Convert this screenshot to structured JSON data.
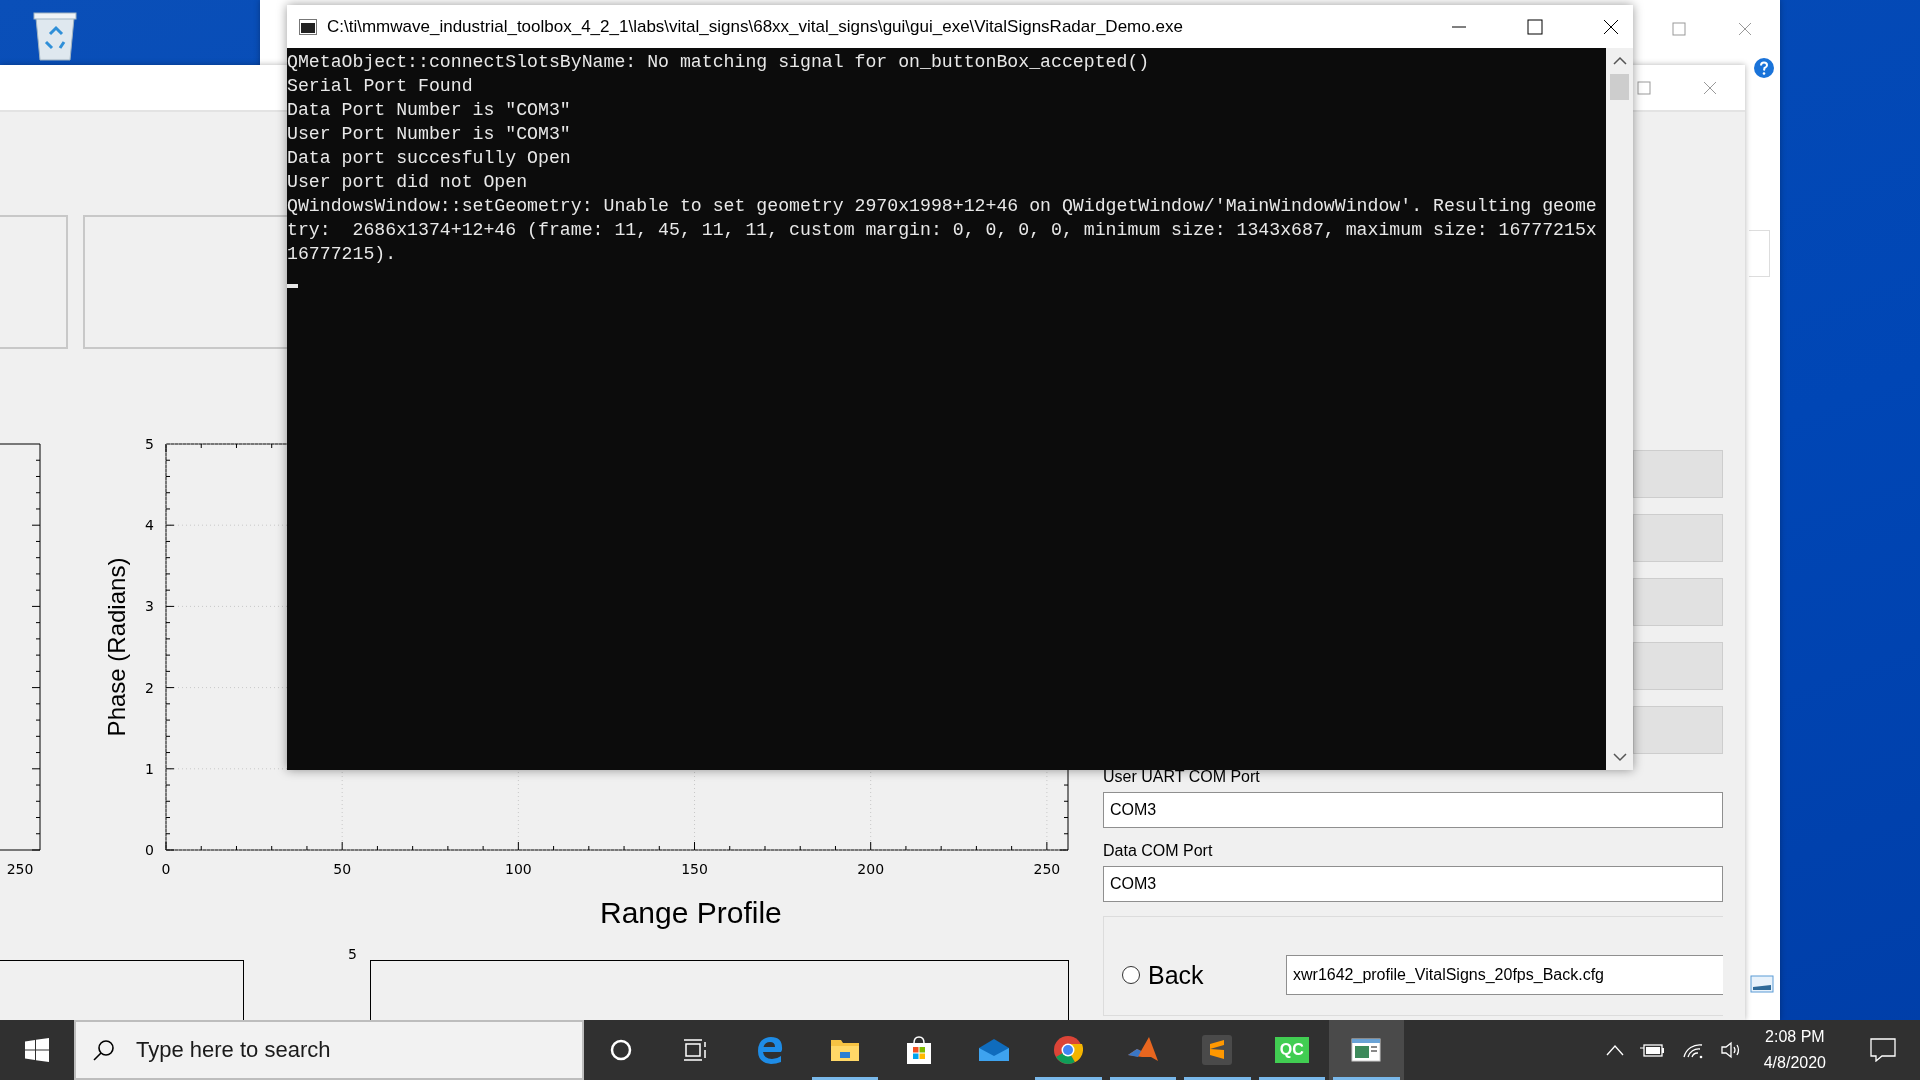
{
  "console": {
    "title": "C:\\ti\\mmwave_industrial_toolbox_4_2_1\\labs\\vital_signs\\68xx_vital_signs\\gui\\gui_exe\\VitalSignsRadar_Demo.exe",
    "lines": [
      "QMetaObject::connectSlotsByName: No matching signal for on_buttonBox_accepted()",
      "Serial Port Found",
      "Data Port Number is \"COM3\"",
      "User Port Number is \"COM3\"",
      "Data port succesfully Open",
      "User port did not Open",
      "QWindowsWindow::setGeometry: Unable to set geometry 2970x1998+12+46 on QWidgetWindow/'MainWindowWindow'. Resulting geome",
      "try:  2686x1374+12+46 (frame: 11, 45, 11, 11, custom margin: 0, 0, 0, 0, minimum size: 1343x687, maximum size: 16777215x",
      "16777215)."
    ]
  },
  "app": {
    "left_plot": {
      "x_tick": "250"
    },
    "phase_plot": {
      "chart_data": {
        "type": "line",
        "grid": true,
        "ylabel": "Phase (Radians)",
        "xlim": [
          0,
          256
        ],
        "ylim": [
          0,
          5
        ],
        "xticks": [
          0,
          50,
          100,
          150,
          200,
          250
        ],
        "yticks": [
          0,
          1,
          2,
          3,
          4,
          5
        ]
      }
    },
    "range_profile_title": "Range Profile",
    "lower_plot": {
      "y_tick": "5"
    },
    "user_uart": {
      "label": "User UART COM Port",
      "value": "COM3"
    },
    "data_com": {
      "label": "Data COM Port",
      "value": "COM3"
    },
    "profiles": [
      {
        "label": "Back",
        "selected": false,
        "file": "xwr1642_profile_VitalSigns_20fps_Back.cfg"
      }
    ]
  },
  "taskbar": {
    "search_placeholder": "Type here to search",
    "apps": [
      {
        "kind": "cortana",
        "running": false,
        "active": false
      },
      {
        "kind": "taskview",
        "running": false,
        "active": false
      },
      {
        "kind": "edge",
        "running": false,
        "active": false
      },
      {
        "kind": "folder",
        "running": true,
        "active": false
      },
      {
        "kind": "store",
        "running": false,
        "active": false
      },
      {
        "kind": "mail",
        "running": false,
        "active": false
      },
      {
        "kind": "chrome",
        "running": true,
        "active": false
      },
      {
        "kind": "matlab",
        "running": true,
        "active": false
      },
      {
        "kind": "sublime",
        "running": true,
        "active": false
      },
      {
        "kind": "qc",
        "label": "QC",
        "running": true,
        "active": false
      },
      {
        "kind": "window",
        "running": true,
        "active": true
      }
    ],
    "time": "2:08 PM",
    "date": "4/8/2020"
  }
}
